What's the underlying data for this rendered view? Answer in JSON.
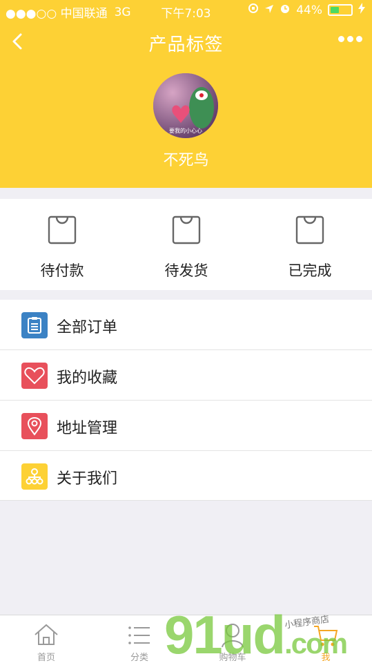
{
  "status_bar": {
    "carrier": "●●●○○ 中国联通",
    "network": "3G",
    "time": "下午7:03",
    "battery_percent": "44%",
    "battery_level": 0.44
  },
  "nav": {
    "title": "产品标签"
  },
  "profile": {
    "username": "不死鸟",
    "avatar_caption": "要我的小心心"
  },
  "orders": [
    {
      "label": "待付款",
      "icon": "shopping-bag-icon"
    },
    {
      "label": "待发货",
      "icon": "shopping-bag-icon"
    },
    {
      "label": "已完成",
      "icon": "shopping-bag-icon"
    }
  ],
  "menu": [
    {
      "label": "全部订单",
      "icon": "clipboard-icon",
      "color": "#3b82c4"
    },
    {
      "label": "我的收藏",
      "icon": "heart-icon",
      "color": "#e8505b"
    },
    {
      "label": "地址管理",
      "icon": "location-pin-icon",
      "color": "#e8505b"
    },
    {
      "label": "关于我们",
      "icon": "org-chart-icon",
      "color": "#fdd135"
    }
  ],
  "tabs": [
    {
      "label": "首页",
      "icon": "home-icon"
    },
    {
      "label": "分类",
      "icon": "list-icon"
    },
    {
      "label": "购物车",
      "icon": "cart-icon"
    },
    {
      "label": "我",
      "icon": "person-icon"
    }
  ],
  "watermark": {
    "brand": "91",
    "brand2": "ud",
    "domain": ".com",
    "tagline": "小程序商店"
  },
  "colors": {
    "accent": "#fdd135",
    "tab_active": "#f5a623"
  }
}
